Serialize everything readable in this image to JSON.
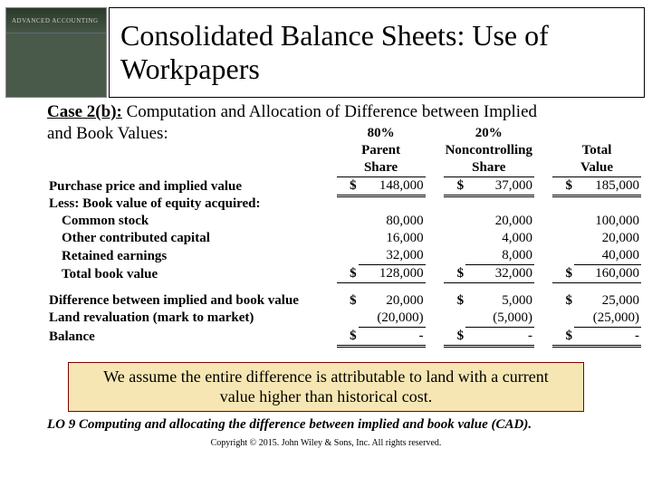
{
  "thumb_label": "ADVANCED ACCOUNTING",
  "title": "Consolidated Balance Sheets: Use of Workpapers",
  "case_lead": "Case 2(b):",
  "case_text_1": "  Computation and Allocation of Difference between Implied",
  "case_text_2": "and Book Values:",
  "hdr": {
    "p_pct": "80%",
    "p_l1": "Parent",
    "p_l2": "Share",
    "n_pct": "20%",
    "n_l1": "Noncontrolling",
    "n_l2": "Share",
    "t_l1": "Total",
    "t_l2": "Value"
  },
  "rows": {
    "r1": "Purchase price and implied value",
    "r2": "Less: Book value of equity acquired:",
    "r3": "Common stock",
    "r4": "Other contributed capital",
    "r5": "Retained earnings",
    "r6": "Total book value",
    "r7": "Difference between implied and book value",
    "r8": "Land revaluation (mark to market)",
    "r9": "Balance"
  },
  "v": {
    "p1": "148,000",
    "n1": "37,000",
    "t1": "185,000",
    "p3": "80,000",
    "n3": "20,000",
    "t3": "100,000",
    "p4": "16,000",
    "n4": "4,000",
    "t4": "20,000",
    "p5": "32,000",
    "n5": "8,000",
    "t5": "40,000",
    "p6": "128,000",
    "n6": "32,000",
    "t6": "160,000",
    "p7": "20,000",
    "n7": "5,000",
    "t7": "25,000",
    "p8": "(20,000)",
    "n8": "(5,000)",
    "t8": "(25,000)",
    "p9": "-",
    "n9": "-",
    "t9": "-"
  },
  "note": "We assume the entire difference is attributable to land with a current value higher than historical cost.",
  "lo": "LO 9  Computing and allocating the difference between implied and book value (CAD).",
  "copyright": "Copyright © 2015. John Wiley & Sons, Inc. All rights reserved.",
  "chart_data": {
    "type": "table",
    "title": "Computation and Allocation of Difference between Implied and Book Values",
    "columns": [
      "80% Parent Share",
      "20% Noncontrolling Share",
      "Total Value"
    ],
    "rows": [
      {
        "label": "Purchase price and implied value",
        "values": [
          148000,
          37000,
          185000
        ]
      },
      {
        "label": "Common stock",
        "values": [
          80000,
          20000,
          100000
        ]
      },
      {
        "label": "Other contributed capital",
        "values": [
          16000,
          4000,
          20000
        ]
      },
      {
        "label": "Retained earnings",
        "values": [
          32000,
          8000,
          40000
        ]
      },
      {
        "label": "Total book value",
        "values": [
          128000,
          32000,
          160000
        ]
      },
      {
        "label": "Difference between implied and book value",
        "values": [
          20000,
          5000,
          25000
        ]
      },
      {
        "label": "Land revaluation (mark to market)",
        "values": [
          -20000,
          -5000,
          -25000
        ]
      },
      {
        "label": "Balance",
        "values": [
          0,
          0,
          0
        ]
      }
    ]
  }
}
